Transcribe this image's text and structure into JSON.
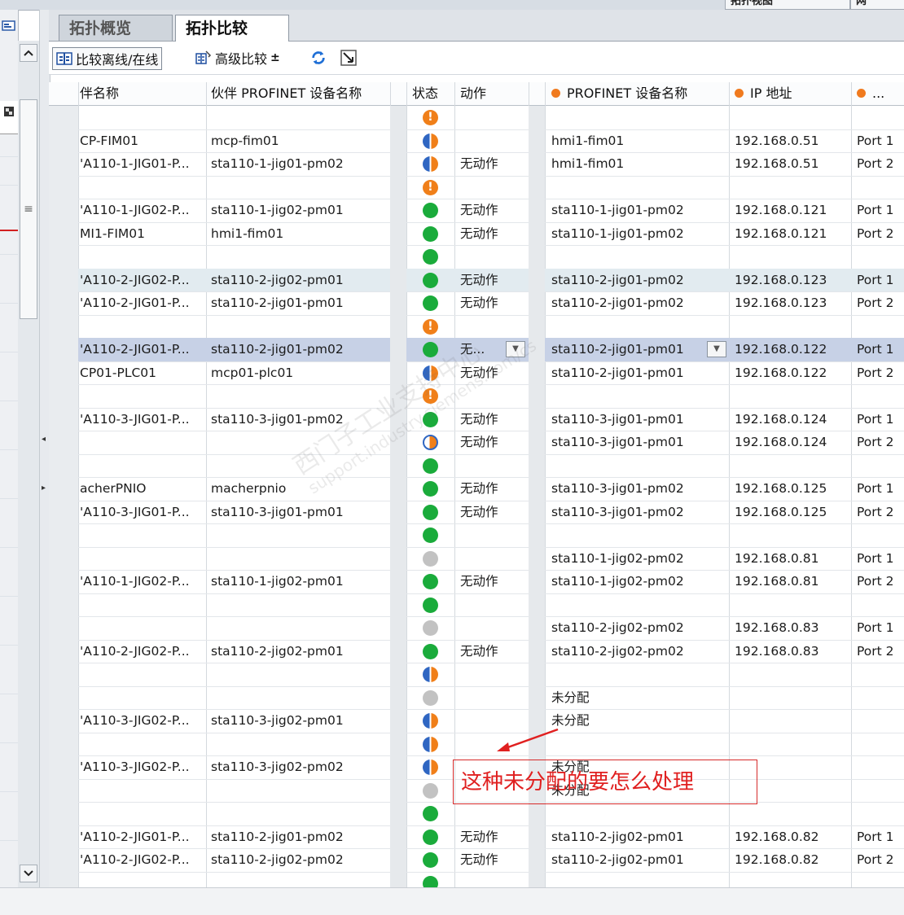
{
  "window": {
    "top_tabs": [
      "拓扑视图",
      "网"
    ]
  },
  "tabs": [
    {
      "label": "拓扑概览",
      "active": false
    },
    {
      "label": "拓扑比较",
      "active": true
    }
  ],
  "toolbar": {
    "compare_offline_online": "比较离线/在线",
    "advanced_compare": "高级比较",
    "advanced_compare_arrow": "±"
  },
  "table": {
    "headers": [
      "伴名称",
      "伙伴 PROFINET 设备名称",
      "状态",
      "动作",
      "PROFINET 设备名称",
      "IP 地址",
      "..."
    ],
    "rows": [
      {
        "partner": "",
        "partner_profinet": "",
        "status": "warn",
        "action": "",
        "profinet": "",
        "ip": "",
        "port": ""
      },
      {
        "partner": "CP-FIM01",
        "partner_profinet": "mcp-fim01",
        "status": "half",
        "action": "",
        "profinet": "hmi1-fim01",
        "ip": "192.168.0.51",
        "port": "Port 1"
      },
      {
        "partner": "'A110-1-JIG01-P...",
        "partner_profinet": "sta110-1-jig01-pm02",
        "status": "half",
        "action": "无动作",
        "profinet": "hmi1-fim01",
        "ip": "192.168.0.51",
        "port": "Port 2"
      },
      {
        "partner": "",
        "partner_profinet": "",
        "status": "warn",
        "action": "",
        "profinet": "",
        "ip": "",
        "port": ""
      },
      {
        "partner": "'A110-1-JIG02-P...",
        "partner_profinet": "sta110-1-jig02-pm01",
        "status": "ok",
        "action": "无动作",
        "profinet": "sta110-1-jig01-pm02",
        "ip": "192.168.0.121",
        "port": "Port 1"
      },
      {
        "partner": "MI1-FIM01",
        "partner_profinet": "hmi1-fim01",
        "status": "ok",
        "action": "无动作",
        "profinet": "sta110-1-jig01-pm02",
        "ip": "192.168.0.121",
        "port": "Port 2"
      },
      {
        "partner": "",
        "partner_profinet": "",
        "status": "ok",
        "action": "",
        "profinet": "",
        "ip": "",
        "port": ""
      },
      {
        "partner": "'A110-2-JIG02-P...",
        "partner_profinet": "sta110-2-jig02-pm01",
        "status": "ok",
        "action": "无动作",
        "profinet": "sta110-2-jig01-pm02",
        "ip": "192.168.0.123",
        "port": "Port 1"
      },
      {
        "partner": "'A110-2-JIG01-P...",
        "partner_profinet": "sta110-2-jig01-pm01",
        "status": "ok",
        "action": "无动作",
        "profinet": "sta110-2-jig01-pm02",
        "ip": "192.168.0.123",
        "port": "Port 2"
      },
      {
        "partner": "",
        "partner_profinet": "",
        "status": "warn",
        "action": "",
        "profinet": "",
        "ip": "",
        "port": ""
      },
      {
        "partner": "'A110-2-JIG01-P...",
        "partner_profinet": "sta110-2-jig01-pm02",
        "status": "ok",
        "action": "无...",
        "profinet": "sta110-2-jig01-pm01",
        "ip": "192.168.0.122",
        "port": "Port 1",
        "selected": true
      },
      {
        "partner": "CP01-PLC01",
        "partner_profinet": "mcp01-plc01",
        "status": "half",
        "action": "无动作",
        "profinet": "sta110-2-jig01-pm01",
        "ip": "192.168.0.122",
        "port": "Port 2"
      },
      {
        "partner": "",
        "partner_profinet": "",
        "status": "warn",
        "action": "",
        "profinet": "",
        "ip": "",
        "port": ""
      },
      {
        "partner": "'A110-3-JIG01-P...",
        "partner_profinet": "sta110-3-jig01-pm02",
        "status": "ok",
        "action": "无动作",
        "profinet": "sta110-3-jig01-pm01",
        "ip": "192.168.0.124",
        "port": "Port 1"
      },
      {
        "partner": "",
        "partner_profinet": "",
        "status": "halfwarn",
        "action": "无动作",
        "profinet": "sta110-3-jig01-pm01",
        "ip": "192.168.0.124",
        "port": "Port 2"
      },
      {
        "partner": "",
        "partner_profinet": "",
        "status": "ok",
        "action": "",
        "profinet": "",
        "ip": "",
        "port": ""
      },
      {
        "partner": "acherPNIO",
        "partner_profinet": "macherpnio",
        "status": "ok",
        "action": "无动作",
        "profinet": "sta110-3-jig01-pm02",
        "ip": "192.168.0.125",
        "port": "Port 1"
      },
      {
        "partner": "'A110-3-JIG01-P...",
        "partner_profinet": "sta110-3-jig01-pm01",
        "status": "ok",
        "action": "无动作",
        "profinet": "sta110-3-jig01-pm02",
        "ip": "192.168.0.125",
        "port": "Port 2"
      },
      {
        "partner": "",
        "partner_profinet": "",
        "status": "ok",
        "action": "",
        "profinet": "",
        "ip": "",
        "port": ""
      },
      {
        "partner": "",
        "partner_profinet": "",
        "status": "gray",
        "action": "",
        "profinet": "sta110-1-jig02-pm02",
        "ip": "192.168.0.81",
        "port": "Port 1"
      },
      {
        "partner": "'A110-1-JIG02-P...",
        "partner_profinet": "sta110-1-jig02-pm01",
        "status": "ok",
        "action": "无动作",
        "profinet": "sta110-1-jig02-pm02",
        "ip": "192.168.0.81",
        "port": "Port 2"
      },
      {
        "partner": "",
        "partner_profinet": "",
        "status": "ok",
        "action": "",
        "profinet": "",
        "ip": "",
        "port": ""
      },
      {
        "partner": "",
        "partner_profinet": "",
        "status": "gray",
        "action": "",
        "profinet": "sta110-2-jig02-pm02",
        "ip": "192.168.0.83",
        "port": "Port 1"
      },
      {
        "partner": "'A110-2-JIG02-P...",
        "partner_profinet": "sta110-2-jig02-pm01",
        "status": "ok",
        "action": "无动作",
        "profinet": "sta110-2-jig02-pm02",
        "ip": "192.168.0.83",
        "port": "Port 2"
      },
      {
        "partner": "",
        "partner_profinet": "",
        "status": "half",
        "action": "",
        "profinet": "",
        "ip": "",
        "port": ""
      },
      {
        "partner": "",
        "partner_profinet": "",
        "status": "gray",
        "action": "",
        "profinet": "未分配",
        "ip": "",
        "port": ""
      },
      {
        "partner": "'A110-3-JIG02-P...",
        "partner_profinet": "sta110-3-jig02-pm01",
        "status": "half",
        "action": "",
        "profinet": "未分配",
        "ip": "",
        "port": ""
      },
      {
        "partner": "",
        "partner_profinet": "",
        "status": "half",
        "action": "",
        "profinet": "",
        "ip": "",
        "port": ""
      },
      {
        "partner": "'A110-3-JIG02-P...",
        "partner_profinet": "sta110-3-jig02-pm02",
        "status": "half",
        "action": "",
        "profinet": "未分配",
        "ip": "",
        "port": ""
      },
      {
        "partner": "",
        "partner_profinet": "",
        "status": "gray",
        "action": "",
        "profinet": "未分配",
        "ip": "",
        "port": ""
      },
      {
        "partner": "",
        "partner_profinet": "",
        "status": "ok",
        "action": "",
        "profinet": "",
        "ip": "",
        "port": ""
      },
      {
        "partner": "'A110-2-JIG01-P...",
        "partner_profinet": "sta110-2-jig01-pm02",
        "status": "ok",
        "action": "无动作",
        "profinet": "sta110-2-jig02-pm01",
        "ip": "192.168.0.82",
        "port": "Port 1"
      },
      {
        "partner": "'A110-2-JIG02-P...",
        "partner_profinet": "sta110-2-jig02-pm02",
        "status": "ok",
        "action": "无动作",
        "profinet": "sta110-2-jig02-pm01",
        "ip": "192.168.0.82",
        "port": "Port 2"
      },
      {
        "partner": "",
        "partner_profinet": "",
        "status": "ok",
        "action": "",
        "profinet": "",
        "ip": "",
        "port": ""
      }
    ]
  },
  "annotation": {
    "text": "这种未分配的要怎么处理",
    "color": "#e02020"
  },
  "watermark": {
    "line1": "西门子工业支持中心",
    "line2": "support.industry.siemens.com/cs"
  },
  "colors": {
    "status_ok": "#1aab3b",
    "status_warning": "#f07f19",
    "status_mixed_blue": "#2f66c2",
    "status_unknown": "#c2c2c2",
    "selected_row": "#c7d1e6"
  }
}
